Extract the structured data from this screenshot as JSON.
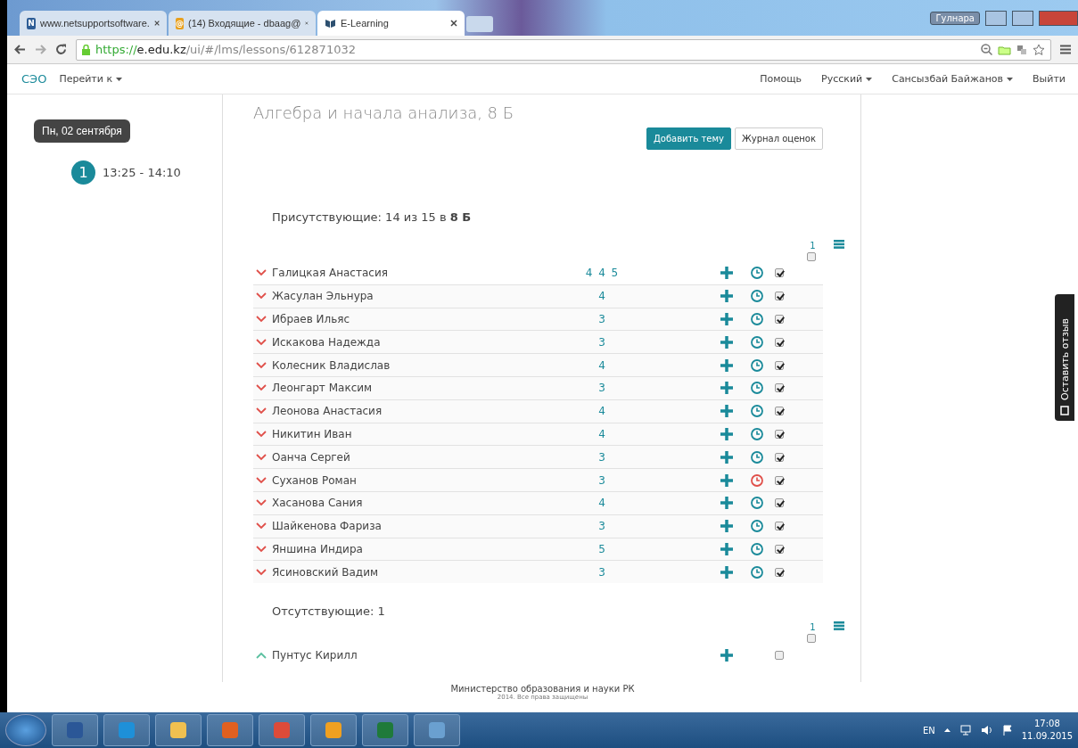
{
  "browser": {
    "tabs": [
      {
        "title": "www.netsupportsoftware.",
        "icon": "N",
        "selected": false
      },
      {
        "title": "(14) Входящие - dbaag@",
        "icon": "@",
        "selected": false
      },
      {
        "title": "E-Learning",
        "selected": true
      }
    ],
    "user_badge": "Гулнара",
    "url_scheme": "https://",
    "url_host": "e.edu.kz",
    "url_path": "/ui/#/lms/lessons/612871032"
  },
  "navbar": {
    "brand": "СЭО",
    "goto": "Перейти к",
    "links": [
      {
        "label": "Помощь",
        "dropdown": false
      },
      {
        "label": "Русский",
        "dropdown": true
      },
      {
        "label": "Сансызбай Байжанов",
        "dropdown": true
      },
      {
        "label": "Выйти",
        "dropdown": false
      }
    ]
  },
  "sidebar": {
    "date": "Пн, 02 сентября",
    "lessons": [
      {
        "number": "1",
        "time": "13:25 - 14:10",
        "selected": true
      }
    ]
  },
  "lesson": {
    "title": "Алгебра и начала анализа, 8 Б",
    "buttons": [
      {
        "label": "Добавить тему",
        "kind": "primary"
      },
      {
        "label": "Журнал оценок",
        "kind": "default"
      }
    ],
    "present": {
      "heading": "Присутствующие: 14 из 15 в **8 Б**",
      "column": "1",
      "all_checked": false,
      "students": [
        {
          "name": "Галицкая Анастасия",
          "grades": "4 4 5",
          "late": false,
          "checked": true
        },
        {
          "name": "Жасулан Эльнура",
          "grades": "4",
          "late": false,
          "checked": true
        },
        {
          "name": "Ибраев Ильяс",
          "grades": "3",
          "late": false,
          "checked": true
        },
        {
          "name": "Искакова Надежда",
          "grades": "3",
          "late": false,
          "checked": true
        },
        {
          "name": "Колесник Владислав",
          "grades": "4",
          "late": false,
          "checked": true
        },
        {
          "name": "Леонгарт Максим",
          "grades": "3",
          "late": false,
          "checked": true
        },
        {
          "name": "Леонова Анастасия",
          "grades": "4",
          "late": false,
          "checked": true
        },
        {
          "name": "Никитин Иван",
          "grades": "4",
          "late": false,
          "checked": true
        },
        {
          "name": "Оанча Сергей",
          "grades": "3",
          "late": false,
          "checked": true
        },
        {
          "name": "Суханов Роман",
          "grades": "3",
          "late": true,
          "checked": true
        },
        {
          "name": "Хасанова Сания",
          "grades": "4",
          "late": false,
          "checked": true
        },
        {
          "name": "Шайкенова Фариза",
          "grades": "3",
          "late": false,
          "checked": true
        },
        {
          "name": "Яншина Индира",
          "grades": "5",
          "late": false,
          "checked": true
        },
        {
          "name": "Ясиновский Вадим",
          "grades": "3",
          "late": false,
          "checked": true
        }
      ]
    },
    "absent": {
      "heading": "Отсутствующие: 1",
      "column": "1",
      "all_checked": false,
      "students": [
        {
          "name": "Пунтус Кирилл",
          "checked": false
        }
      ]
    }
  },
  "feedback_tab": "Оставить отзыв",
  "footer": {
    "ministry": "Министерство образования и науки РК",
    "copyright": "2014. Все права защищены"
  },
  "taskbar": {
    "language": "EN",
    "time": "17:08",
    "date": "11.09.2015"
  }
}
